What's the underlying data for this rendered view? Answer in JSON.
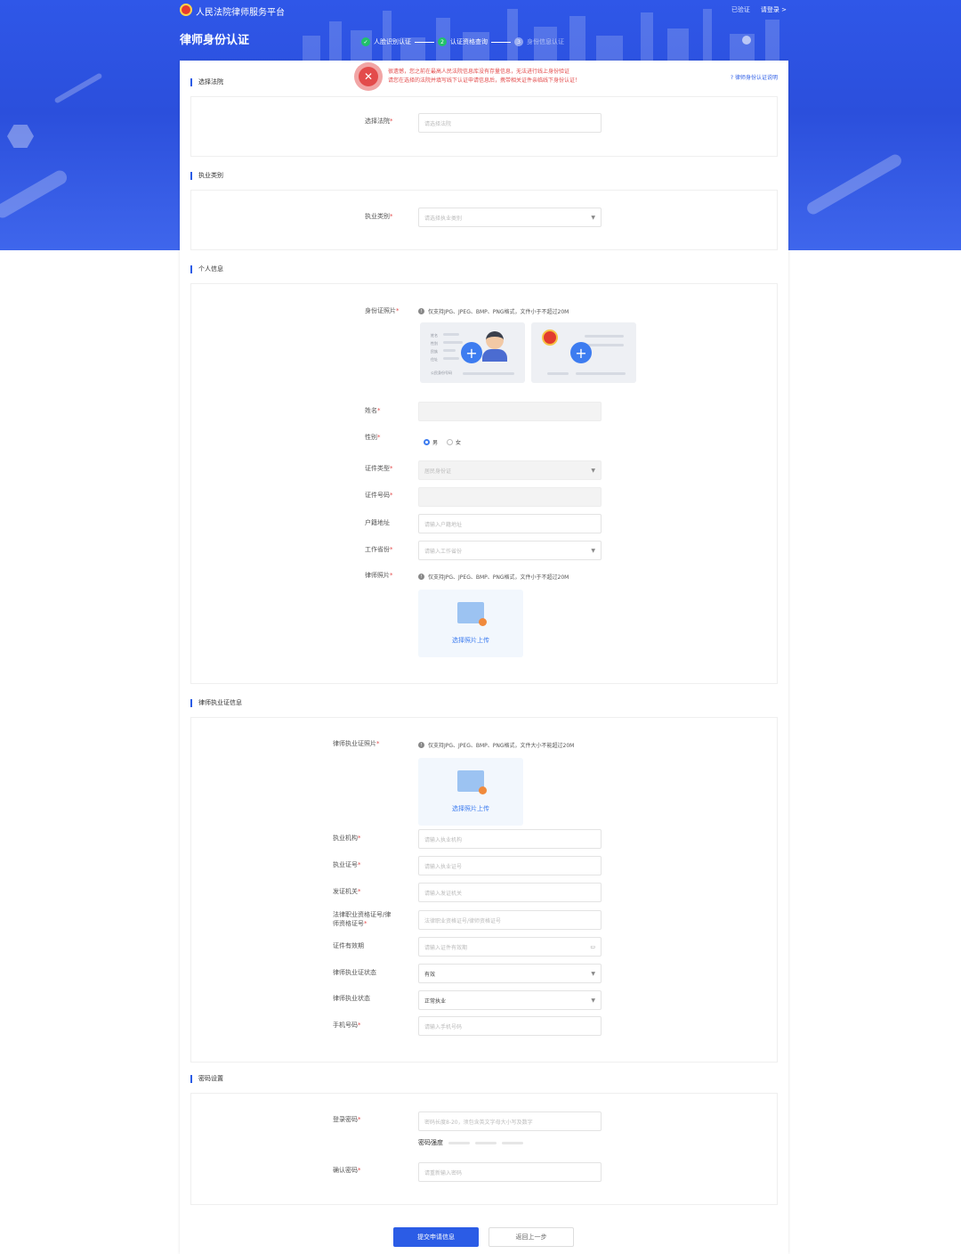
{
  "header": {
    "site_title": "人民法院律师服务平台",
    "verified_link": "已验证",
    "login_link": "请登录 >",
    "page_title": "律师身份认证"
  },
  "steps": [
    {
      "label": "人脸识别认证",
      "status": "done",
      "marker": "✓"
    },
    {
      "label": "认证资格查询",
      "status": "current",
      "marker": "2"
    },
    {
      "label": "身份信息认证",
      "status": "todo",
      "marker": "3"
    }
  ],
  "alert": {
    "icon": "shield-error-icon",
    "line1": "很遗憾，您之前在最高人民法院信息库没有存量信息，无法进行线上身份验证",
    "line2": "请您在选择的法院并填写线下认证申请信息后，携带相关证件亲临线下身份认证！",
    "help": "律师身份认证说明"
  },
  "sections": {
    "court": {
      "title": "选择法院",
      "label": "选择法院",
      "placeholder": "请选择法院"
    },
    "practice": {
      "title": "执业类别",
      "label": "执业类别",
      "placeholder": "请选择执业类别"
    },
    "personal": {
      "title": "个人信息",
      "id_photo_label": "身份证照片",
      "file_hint": "仅支持JPG、JPEG、BMP、PNG格式，文件小于不超过20M",
      "id_front_lines": [
        "姓名",
        "性别",
        "民族",
        "住址"
      ],
      "id_number_caption": "公民身份号码",
      "name_label": "姓名",
      "name_value": "",
      "gender_label": "性别",
      "gender_options": [
        "男",
        "女"
      ],
      "gender_selected": "男",
      "cert_type_label": "证件类型",
      "cert_type_value": "居民身份证",
      "cert_no_label": "证件号码",
      "cert_no_value": "",
      "address_label": "户籍地址",
      "address_placeholder": "请输入户籍地址",
      "province_label": "工作省份",
      "province_placeholder": "请输入工作省份",
      "lawyer_photo_label": "律师照片",
      "lawyer_photo_hint": "仅支持JPG、JPEG、BMP、PNG格式，文件小于不超过20M",
      "upload_text": "选择照片上传"
    },
    "license": {
      "title": "律师执业证信息",
      "photo_label": "律师执业证照片",
      "photo_hint": "仅支持JPG、JPEG、BMP、PNG格式，文件大小不能超过20M",
      "upload_text": "选择照片上传",
      "org_label": "执业机构",
      "org_placeholder": "请输入执业机构",
      "lic_no_label": "执业证号",
      "lic_no_placeholder": "请输入执业证号",
      "issuer_label": "发证机关",
      "issuer_placeholder": "请输入发证机关",
      "qual_label_1": "法律职业资格证号/律",
      "qual_label_2": "师资格证号",
      "qual_placeholder": "法律职业资格证号/律师资格证号",
      "valid_label": "证件有效期",
      "valid_placeholder": "请输入证件有效期",
      "status_label": "律师执业证状态",
      "status_value": "有效",
      "practice_status_label": "律师执业状态",
      "practice_status_value": "正常执业",
      "phone_label": "手机号码",
      "phone_placeholder": "请输入手机号码"
    },
    "password": {
      "title": "密码设置",
      "pwd_label": "登录密码",
      "pwd_placeholder": "密码长度8-20，须包含英文字母大小写及数字",
      "strength_label": "密码强度",
      "confirm_label": "确认密码",
      "confirm_placeholder": "请重新输入密码"
    }
  },
  "actions": {
    "submit": "提交申请信息",
    "back": "返回上一步"
  },
  "colors": {
    "primary": "#2b5ce6",
    "banner": "#2f57e8",
    "error": "#e34b4b",
    "success": "#21c16b"
  }
}
